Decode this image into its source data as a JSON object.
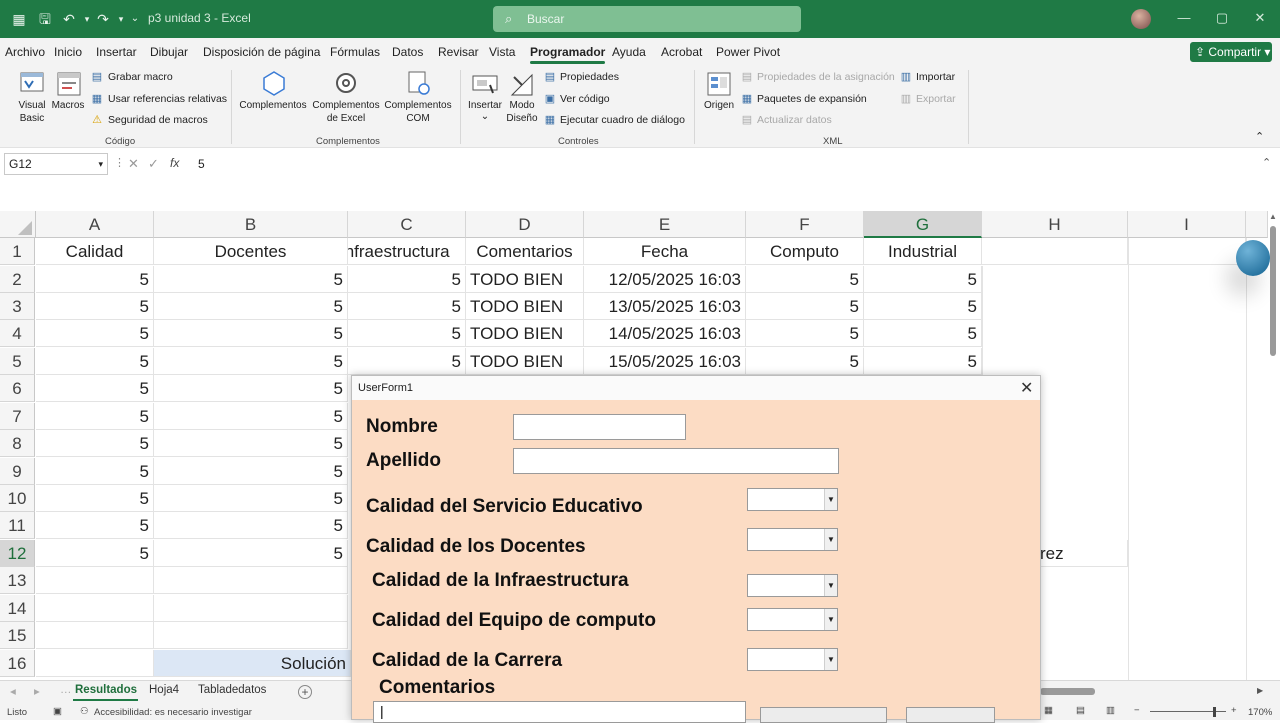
{
  "titlebar": {
    "filename": "p3 unidad 3  -  Excel",
    "search_placeholder": "Buscar",
    "search_icon": "search-icon",
    "autosave_icon": "excel-icon",
    "window_buttons": [
      "minimize",
      "restore",
      "close"
    ]
  },
  "menu": {
    "items": [
      "Archivo",
      "Inicio",
      "Insertar",
      "Dibujar",
      "Disposición de página",
      "Fórmulas",
      "Datos",
      "Revisar",
      "Vista",
      "Programador",
      "Ayuda",
      "Acrobat",
      "Power Pivot"
    ],
    "active": "Programador",
    "share_label": "Compartir"
  },
  "ribbon": {
    "codigo": {
      "group_label": "Código",
      "visual_basic": "Visual\nBasic",
      "macros": "Macros",
      "grabar": "Grabar macro",
      "referencias": "Usar referencias relativas",
      "seguridad": "Seguridad de macros"
    },
    "complementos": {
      "group_label": "Complementos",
      "complementos": "Complementos",
      "excel": "Complementos\nde Excel",
      "com": "Complementos\nCOM"
    },
    "controles": {
      "group_label": "Controles",
      "insertar": "Insertar",
      "modo": "Modo\nDiseño",
      "propiedades": "Propiedades",
      "ver_codigo": "Ver código",
      "ejecutar": "Ejecutar cuadro de diálogo"
    },
    "xml": {
      "group_label": "XML",
      "origen": "Origen",
      "propiedades_asig": "Propiedades de la asignación",
      "paquetes": "Paquetes de expansión",
      "actualizar": "Actualizar datos",
      "importar": "Importar",
      "exportar": "Exportar"
    }
  },
  "formula_bar": {
    "name_box": "G12",
    "fx": "fx",
    "value": "5"
  },
  "columns": [
    "A",
    "B",
    "C",
    "D",
    "E",
    "F",
    "G",
    "H",
    "I"
  ],
  "selected_column": "G",
  "selected_row": "12",
  "rows": [
    "1",
    "2",
    "3",
    "4",
    "5",
    "6",
    "7",
    "8",
    "9",
    "10",
    "11",
    "12",
    "13",
    "14",
    "15",
    "16"
  ],
  "headers_row": [
    "Calidad",
    "Docentes",
    "Infraestructura",
    "Comentarios",
    "Fecha",
    "Computo",
    "Industrial"
  ],
  "data_rows": [
    [
      "5",
      "5",
      "5",
      "TODO BIEN",
      "12/05/2025 16:03",
      "5",
      "5"
    ],
    [
      "5",
      "5",
      "5",
      "TODO BIEN",
      "13/05/2025 16:03",
      "5",
      "5"
    ],
    [
      "5",
      "5",
      "5",
      "TODO BIEN",
      "14/05/2025 16:03",
      "5",
      "5"
    ],
    [
      "5",
      "5",
      "5",
      "TODO BIEN",
      "15/05/2025 16:03",
      "5",
      "5"
    ]
  ],
  "partial_rows": [
    "5",
    "5",
    "5",
    "5",
    "5",
    "5",
    "5"
  ],
  "h12_text": "rez",
  "b16_text": "Solución",
  "sheets": {
    "tabs": [
      "Resultados",
      "Hoja4",
      "Tabladedatos"
    ],
    "active": "Resultados"
  },
  "status": {
    "ready": "Listo",
    "accessibility": "Accesibilidad: es necesario investigar",
    "zoom": "170%"
  },
  "userform": {
    "title": "UserForm1",
    "labels": {
      "nombre": "Nombre",
      "apellido": "Apellido",
      "servicio": "Calidad del Servicio Educativo",
      "docentes": "Calidad de los Docentes",
      "infra": "Calidad de la Infraestructura",
      "equipo": "Calidad del Equipo de computo",
      "carrera": "Calidad de la Carrera",
      "comentarios": "Comentarios"
    },
    "nombre_value": "",
    "apellido_value": "",
    "comentarios_value": "|"
  }
}
